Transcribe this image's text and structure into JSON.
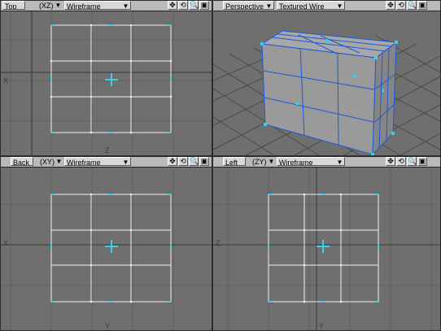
{
  "viewports": [
    {
      "name": "top",
      "view_label": "Top",
      "axis_label": "(XZ)",
      "mode_label": "Wireframe",
      "axis_letters": {
        "left": "X",
        "bottom": "Z"
      }
    },
    {
      "name": "perspective",
      "view_label": "Perspective",
      "axis_label": "",
      "mode_label": "Textured Wire",
      "axis_letters": {}
    },
    {
      "name": "back",
      "view_label": "Back",
      "axis_label": "(XY)",
      "mode_label": "Wireframe",
      "axis_letters": {
        "left": "X",
        "bottom": "Y"
      }
    },
    {
      "name": "left",
      "view_label": "Left",
      "axis_label": "(ZY)",
      "mode_label": "Wireframe",
      "axis_letters": {
        "left": "Z",
        "bottom": "Y"
      }
    }
  ],
  "icons": [
    "move-view-icon",
    "rotate-view-icon",
    "zoom-view-icon",
    "maximize-view-icon"
  ],
  "icon_glyphs": [
    "✥",
    "⟲",
    "🔍",
    "▣"
  ],
  "colors": {
    "viewport_bg": "#6f6f6f",
    "grid_line": "#5d5d5d",
    "axis_line": "#3a3a3a",
    "mesh_edge": "#f0f0f0",
    "selected_point": "#3fd0e0",
    "perspective_wire": "#1a5ad8"
  }
}
